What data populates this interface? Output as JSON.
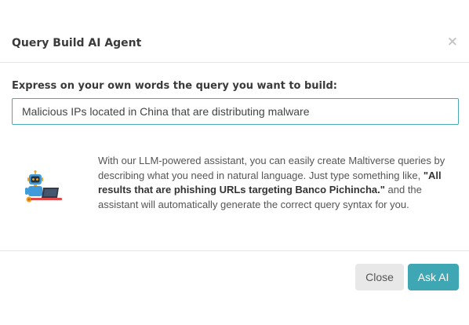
{
  "dialog": {
    "title": "Query Build AI Agent",
    "close_icon": "×"
  },
  "form": {
    "label": "Express on your own words the query you want to build:",
    "query_value": "Malicious IPs located in China that are distributing malware",
    "accent_color": "#49a9b4"
  },
  "info": {
    "icon": "robot-at-laptop-icon",
    "text_before": "With our LLM-powered assistant, you can easily create Maltiverse queries by describing what you need in natural language. Just type something like, ",
    "example": "\"All results that are phishing URLs targeting Banco Pichincha.\"",
    "text_after": " and the assistant will automatically generate the correct query syntax for you."
  },
  "footer": {
    "close_label": "Close",
    "ask_label": "Ask AI",
    "ask_color": "#3fa7b3"
  }
}
